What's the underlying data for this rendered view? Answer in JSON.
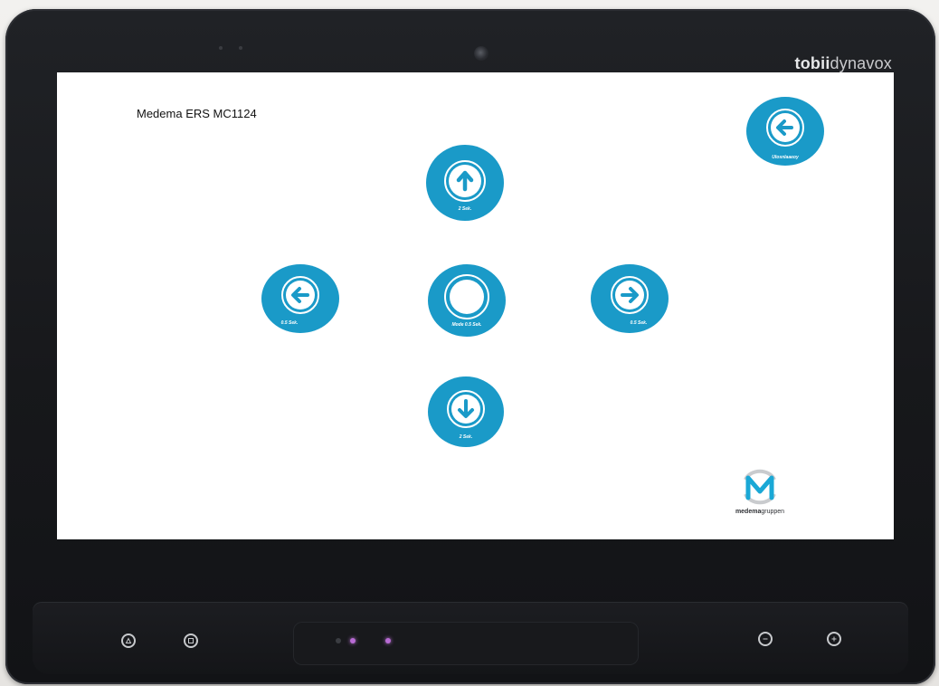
{
  "device": {
    "brand_bold": "tobii",
    "brand_light": "dynavox"
  },
  "screen": {
    "title": "Medema ERS MC1124"
  },
  "controls": {
    "back": {
      "caption": "Ulosnlaaeoy",
      "icon": "arrow-left-circle-icon"
    },
    "up": {
      "caption": "2 Sek.",
      "icon": "arrow-up-circle-icon"
    },
    "left": {
      "caption": "0.5 Sek.",
      "icon": "arrow-left-circle-icon"
    },
    "center": {
      "caption": "Mode 0.5 Sek.",
      "icon": "circle-icon"
    },
    "right": {
      "caption": "0.5 Sek.",
      "icon": "arrow-right-circle-icon"
    },
    "down": {
      "caption": "2 Sek.",
      "icon": "arrow-down-circle-icon"
    }
  },
  "logo": {
    "name_bold": "medema",
    "name_light": "gruppen"
  },
  "colors": {
    "button": "#1a9ac8",
    "screen": "#ffffff",
    "bezel": "#1c1d21",
    "led": "#b86bd4"
  }
}
